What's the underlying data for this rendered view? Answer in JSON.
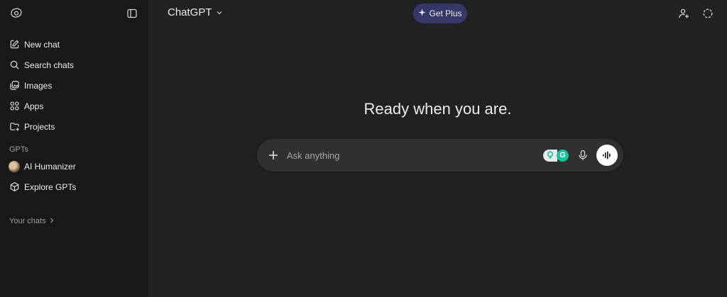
{
  "sidebar": {
    "items": [
      {
        "label": "New chat",
        "icon": "pencil-square-icon"
      },
      {
        "label": "Search chats",
        "icon": "search-icon"
      },
      {
        "label": "Images",
        "icon": "images-icon"
      },
      {
        "label": "Apps",
        "icon": "apps-grid-icon"
      },
      {
        "label": "Projects",
        "icon": "folder-plus-icon"
      }
    ],
    "gpts_label": "GPTs",
    "gpts": [
      {
        "label": "AI Humanizer",
        "icon": "avatar"
      },
      {
        "label": "Explore GPTs",
        "icon": "cube-icon"
      }
    ],
    "your_chats_label": "Your chats"
  },
  "header": {
    "model_name": "ChatGPT",
    "get_plus_label": "Get Plus"
  },
  "main": {
    "heading": "Ready when you are.",
    "composer_placeholder": "Ask anything",
    "extension_badge_letter": "G"
  },
  "colors": {
    "background": "#212121",
    "sidebar": "#181818",
    "composer": "#303030",
    "get_plus": "#373669",
    "grammarly": "#15c39a"
  }
}
